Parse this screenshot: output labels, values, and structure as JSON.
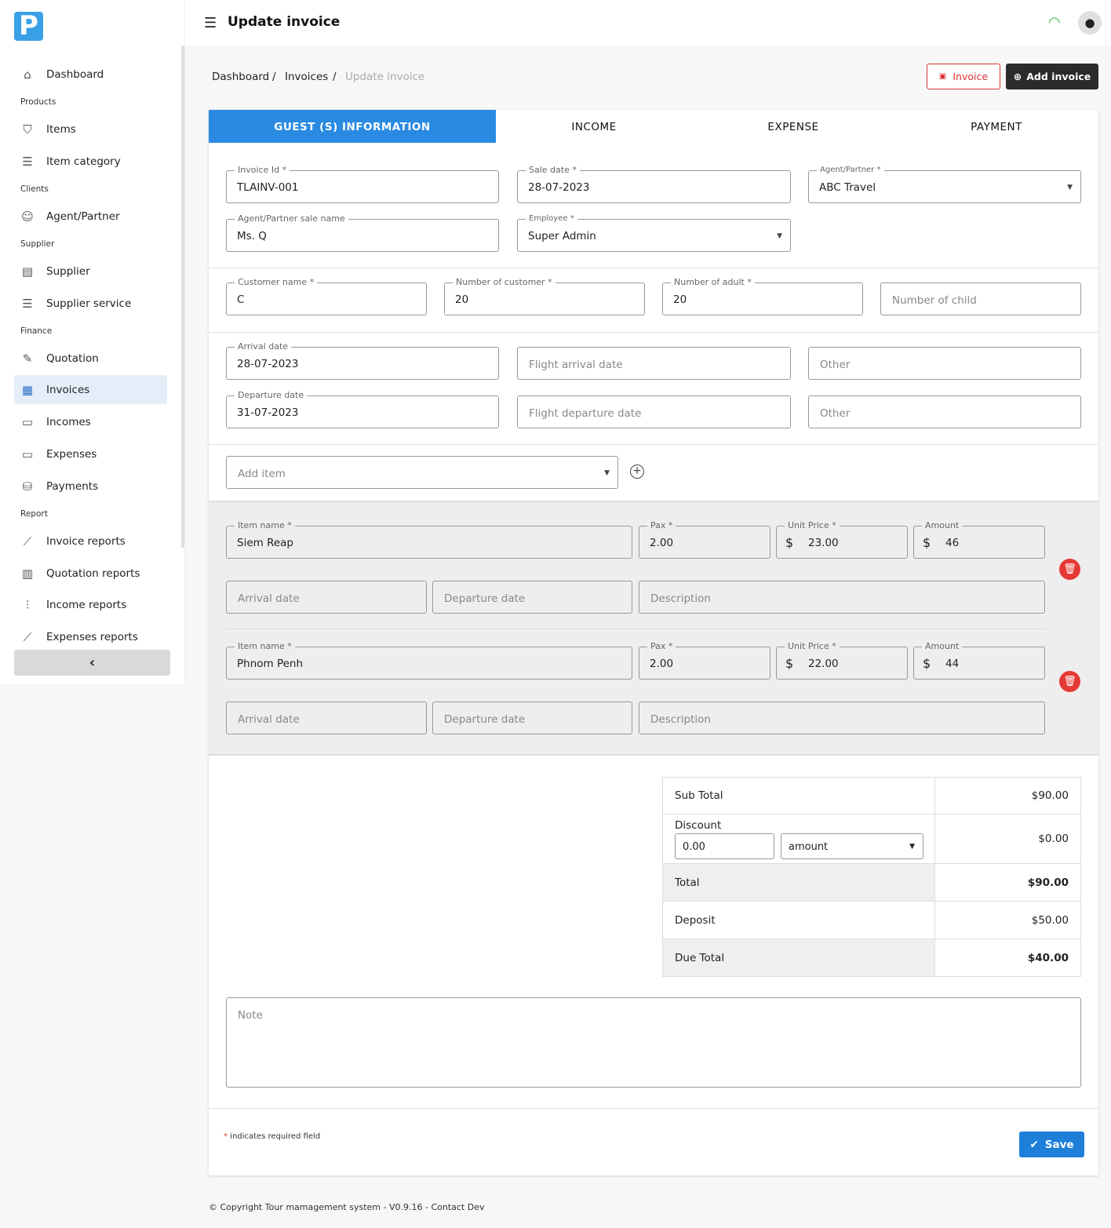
{
  "sidebar": {
    "logo": "P",
    "dashboard": "Dashboard",
    "sec_products": "Products",
    "items": "Items",
    "item_category": "Item category",
    "sec_clients": "Clients",
    "agent_partner": "Agent/Partner",
    "sec_supplier": "Supplier",
    "supplier": "Supplier",
    "supplier_service": "Supplier service",
    "sec_finance": "Finance",
    "quotation": "Quotation",
    "invoices": "Invoices",
    "incomes": "Incomes",
    "expenses": "Expenses",
    "payments": "Payments",
    "sec_report": "Report",
    "invoice_reports": "Invoice reports",
    "quotation_reports": "Quotation reports",
    "income_reports": "Income reports",
    "expenses_reports": "Expenses reports",
    "collapse": "‹"
  },
  "header": {
    "title": "Update invoice"
  },
  "breadcrumb": {
    "dashboard": "Dashboard",
    "sep": "/",
    "invoices": "Invoices",
    "current": "Update invoice"
  },
  "actions": {
    "invoice": "Invoice",
    "add_invoice": "Add invoice"
  },
  "tabs": {
    "guest": "GUEST (S) INFORMATION",
    "income": "INCOME",
    "expense": "EXPENSE",
    "payment": "PAYMENT"
  },
  "form": {
    "invoice_id": {
      "label": "Invoice Id *",
      "value": "TLAINV-001"
    },
    "sale_date": {
      "label": "Sale date *",
      "value": "28-07-2023"
    },
    "agent_partner": {
      "label": "Agent/Partner *",
      "value": "ABC Travel"
    },
    "agent_sale_name": {
      "label": "Agent/Partner sale name",
      "value": "Ms. Q"
    },
    "employee": {
      "label": "Employee *",
      "value": "Super Admin"
    },
    "customer_name": {
      "label": "Customer name *",
      "value": "C"
    },
    "num_customer": {
      "label": "Number of customer *",
      "value": "20"
    },
    "num_adult": {
      "label": "Number of adult *",
      "value": "20"
    },
    "num_child": {
      "placeholder": "Number of child"
    },
    "arrival_date": {
      "label": "Arrival date",
      "value": "28-07-2023"
    },
    "flight_arrival": {
      "placeholder": "Flight arrival date"
    },
    "other1": {
      "placeholder": "Other"
    },
    "departure_date": {
      "label": "Departure date",
      "value": "31-07-2023"
    },
    "flight_departure": {
      "placeholder": "Flight departure date"
    },
    "other2": {
      "placeholder": "Other"
    },
    "add_item": {
      "placeholder": "Add item"
    }
  },
  "items_labels": {
    "item_name": "Item name *",
    "pax": "Pax *",
    "unit_price": "Unit Price *",
    "amount": "Amount",
    "arrival": "Arrival date",
    "departure": "Departure date",
    "description": "Description",
    "currency": "$"
  },
  "items": [
    {
      "name": "Siem Reap",
      "pax": "2.00",
      "unit_price": "23.00",
      "amount": "46"
    },
    {
      "name": "Phnom Penh",
      "pax": "2.00",
      "unit_price": "22.00",
      "amount": "44"
    }
  ],
  "totals": {
    "sub_total_label": "Sub Total",
    "sub_total": "$90.00",
    "discount_label": "Discount",
    "discount_value": "0.00",
    "discount_type": "amount",
    "discount": "$0.00",
    "total_label": "Total",
    "total": "$90.00",
    "deposit_label": "Deposit",
    "deposit": "$50.00",
    "due_label": "Due Total",
    "due": "$40.00"
  },
  "note": {
    "placeholder": "Note"
  },
  "required_note": {
    "star": "*",
    "text": " indicates required field"
  },
  "save": "Save",
  "footer": "© Copyright Tour mamagement system - V0.9.16 - Contact Dev",
  "colors": {
    "primary": "#2a8ae2",
    "danger": "#e53935",
    "dark": "#2b2b2b"
  }
}
